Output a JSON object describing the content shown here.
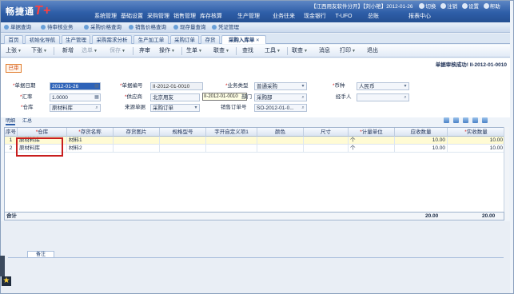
{
  "header": {
    "logo_text": "畅捷通",
    "logo_product": "T+",
    "menus": [
      "基础设置",
      "采购管理",
      "销售管理",
      "库存核算",
      "生产管理",
      "业务往来",
      "现金银行",
      "T-UFO",
      "总账",
      "报表中心"
    ],
    "first_menu": "系统管理",
    "status_text": "【江西用友软件分开】【刘小艳】2012-01-26",
    "actions": [
      "切换",
      "注销",
      "设置",
      "帮助"
    ]
  },
  "quicklinks": [
    "单据查询",
    "待审核业务",
    "采购价格查询",
    "销售价格查询",
    "现存量查询",
    "凭证管理"
  ],
  "tabs": [
    {
      "label": "首页",
      "closable": false
    },
    {
      "label": "初始化导航",
      "closable": false
    },
    {
      "label": "生产管理",
      "closable": false
    },
    {
      "label": "采购需求分析",
      "closable": false
    },
    {
      "label": "生产加工单",
      "closable": false
    },
    {
      "label": "采购订单",
      "closable": false
    },
    {
      "label": "存货",
      "closable": false
    },
    {
      "label": "采购入库单",
      "closable": true
    }
  ],
  "toolbar": {
    "items": [
      "上张",
      "下张",
      "新增",
      "选单",
      "保存",
      "弃审",
      "操作",
      "生单",
      "联查",
      "查找",
      "工具",
      "联查",
      "消息",
      "打印",
      "退出"
    ]
  },
  "form": {
    "audit_stamp": "已审",
    "audit_msg": "单据审核成功! II-2012-01-0010",
    "date_label": "单据日期",
    "date_value": "2012-01-26",
    "docno_label": "单据编号",
    "docno_value": "II-2012-01-0010",
    "biztype_label": "业务类型",
    "biztype_value": "普通采购",
    "currency_label": "币种",
    "currency_value": "人民币",
    "rate_label": "汇率",
    "rate_value": "1.0000",
    "supplier_label": "供应商",
    "supplier_value": "北京用友",
    "tooltip_value": "II-2012-01-0010",
    "dept_label": "部门",
    "dept_value": "采购部",
    "handler_label": "经手人",
    "handler_value": "",
    "warehouse_label": "仓库",
    "warehouse_value": "原材料库",
    "source_label": "来源单据",
    "source_value": "采购订单",
    "order_label": "销售订单号",
    "order_value": "SO-2012-01-0..."
  },
  "subtabs": [
    "明细",
    "汇总"
  ],
  "grid": {
    "headers": [
      "序号",
      "仓库",
      "存货名称",
      "存货图片",
      "规格型号",
      "字开自定义项1",
      "颜色",
      "尺寸",
      "计量单位",
      "应收数量",
      "实收数量"
    ],
    "rows": [
      {
        "no": "1",
        "warehouse": "原材料库",
        "item": "材料1",
        "unit": "个",
        "qty_due": "10.00",
        "qty_recv": "10.00"
      },
      {
        "no": "2",
        "warehouse": "原材料库",
        "item": "材料2",
        "unit": "个",
        "qty_due": "10.00",
        "qty_recv": "10.00"
      }
    ],
    "total_label": "合计",
    "total_due": "20.00",
    "total_recv": "20.00"
  },
  "bottom": {
    "tab_label": "备注"
  }
}
